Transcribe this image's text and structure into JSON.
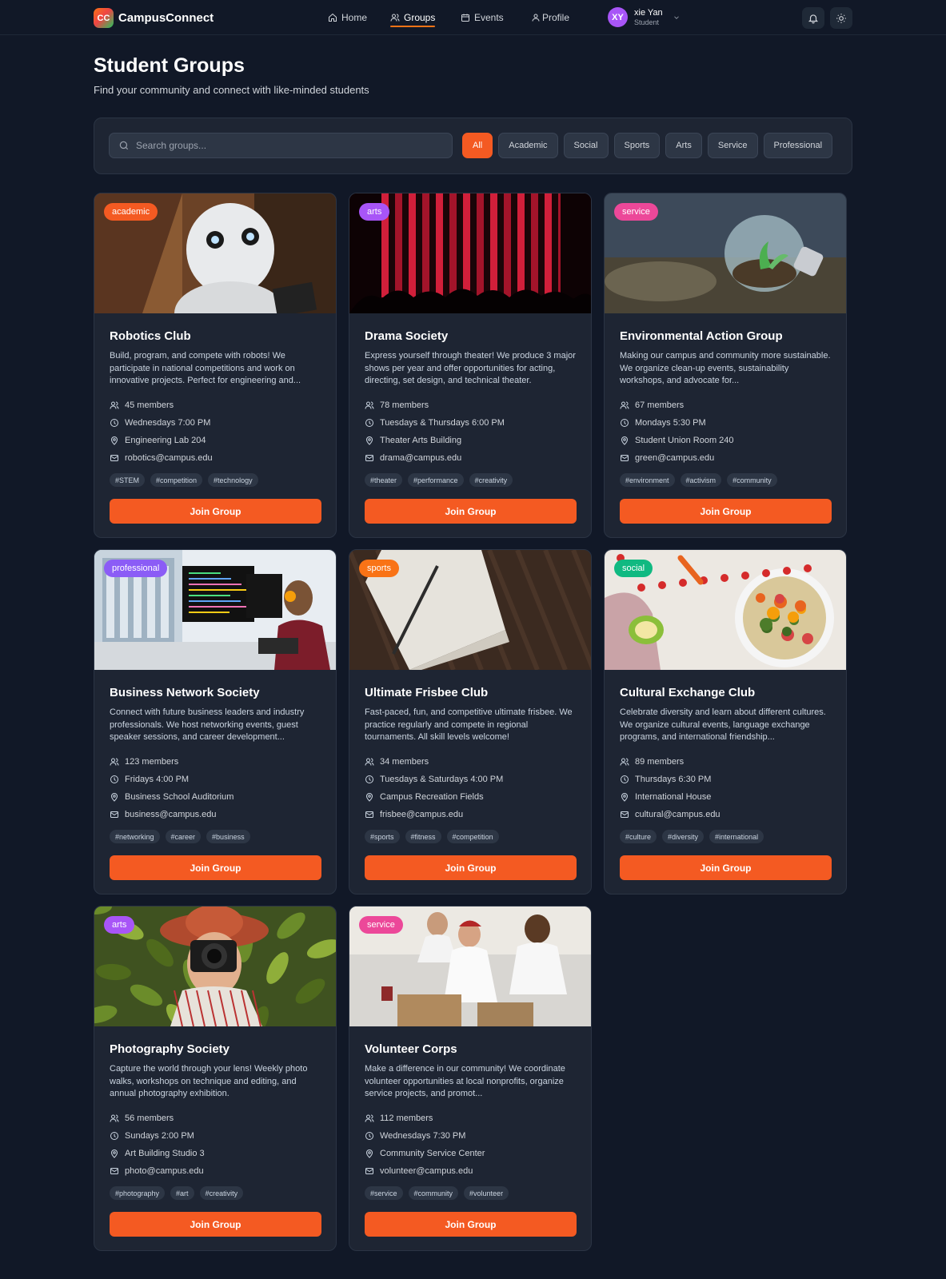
{
  "app": {
    "logo_badge": "CC",
    "name": "CampusConnect"
  },
  "nav": {
    "items": [
      {
        "label": "Home",
        "icon": "home-icon"
      },
      {
        "label": "Groups",
        "icon": "users-icon"
      },
      {
        "label": "Events",
        "icon": "calendar-icon"
      },
      {
        "label": "Profile",
        "icon": "user-icon"
      }
    ],
    "active": "Groups",
    "user": {
      "initials": "XY",
      "name": "xie Yan",
      "role": "Student"
    }
  },
  "header": {
    "title": "Student Groups",
    "subtitle": "Find your community and connect with like-minded students"
  },
  "filters": {
    "search_placeholder": "Search groups...",
    "categories": [
      "All",
      "Academic",
      "Social",
      "Sports",
      "Arts",
      "Service",
      "Professional"
    ],
    "active": "All"
  },
  "colors": {
    "accent": "#f45a22",
    "academic": "#f45a22",
    "arts": "#a855f7",
    "service": "#ec4899",
    "professional": "#8b5cf6",
    "sports": "#f97316",
    "social": "#10b981"
  },
  "join_label": "Join Group",
  "groups": [
    {
      "category": "academic",
      "badge_color": "#f45a22",
      "image": "robot-photo",
      "title": "Robotics Club",
      "description": "Build, program, and compete with robots! We participate in national competitions and work on innovative projects. Perfect for engineering and...",
      "members": "45 members",
      "schedule": "Wednesdays 7:00 PM",
      "location": "Engineering Lab 204",
      "email": "robotics@campus.edu",
      "tags": [
        "#STEM",
        "#competition",
        "#technology"
      ]
    },
    {
      "category": "arts",
      "badge_color": "#a855f7",
      "image": "theater-curtain-photo",
      "title": "Drama Society",
      "description": "Express yourself through theater! We produce 3 major shows per year and offer opportunities for acting, directing, set design, and technical theater.",
      "members": "78 members",
      "schedule": "Tuesdays & Thursdays 6:00 PM",
      "location": "Theater Arts Building",
      "email": "drama@campus.edu",
      "tags": [
        "#theater",
        "#performance",
        "#creativity"
      ]
    },
    {
      "category": "service",
      "badge_color": "#ec4899",
      "image": "lightbulb-plant-photo",
      "title": "Environmental Action Group",
      "description": "Making our campus and community more sustainable. We organize clean-up events, sustainability workshops, and advocate for...",
      "members": "67 members",
      "schedule": "Mondays 5:30 PM",
      "location": "Student Union Room 240",
      "email": "green@campus.edu",
      "tags": [
        "#environment",
        "#activism",
        "#community"
      ]
    },
    {
      "category": "professional",
      "badge_color": "#8b5cf6",
      "image": "developer-desk-photo",
      "title": "Business Network Society",
      "description": "Connect with future business leaders and industry professionals. We host networking events, guest speaker sessions, and career development...",
      "members": "123 members",
      "schedule": "Fridays 4:00 PM",
      "location": "Business School Auditorium",
      "email": "business@campus.edu",
      "tags": [
        "#networking",
        "#career",
        "#business"
      ]
    },
    {
      "category": "sports",
      "badge_color": "#f97316",
      "image": "notebook-photo",
      "title": "Ultimate Frisbee Club",
      "description": "Fast-paced, fun, and competitive ultimate frisbee. We practice regularly and compete in regional tournaments. All skill levels welcome!",
      "members": "34 members",
      "schedule": "Tuesdays & Saturdays 4:00 PM",
      "location": "Campus Recreation Fields",
      "email": "frisbee@campus.edu",
      "tags": [
        "#sports",
        "#fitness",
        "#competition"
      ]
    },
    {
      "category": "social",
      "badge_color": "#10b981",
      "image": "salad-bowl-photo",
      "title": "Cultural Exchange Club",
      "description": "Celebrate diversity and learn about different cultures. We organize cultural events, language exchange programs, and international friendship...",
      "members": "89 members",
      "schedule": "Thursdays 6:30 PM",
      "location": "International House",
      "email": "cultural@campus.edu",
      "tags": [
        "#culture",
        "#diversity",
        "#international"
      ]
    },
    {
      "category": "arts",
      "badge_color": "#a855f7",
      "image": "photographer-photo",
      "title": "Photography Society",
      "description": "Capture the world through your lens! Weekly photo walks, workshops on technique and editing, and annual photography exhibition.",
      "members": "56 members",
      "schedule": "Sundays 2:00 PM",
      "location": "Art Building Studio 3",
      "email": "photo@campus.edu",
      "tags": [
        "#photography",
        "#art",
        "#creativity"
      ]
    },
    {
      "category": "service",
      "badge_color": "#ec4899",
      "image": "volunteers-photo",
      "title": "Volunteer Corps",
      "description": "Make a difference in our community! We coordinate volunteer opportunities at local nonprofits, organize service projects, and promot...",
      "members": "112 members",
      "schedule": "Wednesdays 7:30 PM",
      "location": "Community Service Center",
      "email": "volunteer@campus.edu",
      "tags": [
        "#service",
        "#community",
        "#volunteer"
      ]
    }
  ]
}
